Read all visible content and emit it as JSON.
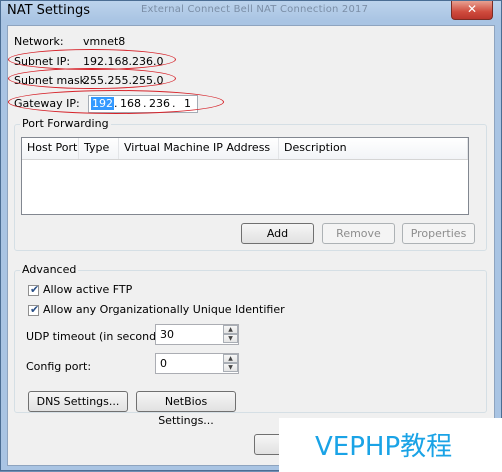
{
  "window": {
    "title": "NAT Settings",
    "background_tabs": "External Connect Bell       NAT Connection    2017",
    "close_glyph": "✕"
  },
  "info": {
    "network_label": "Network:",
    "network_value": "vmnet8",
    "subnet_ip_label": "Subnet IP:",
    "subnet_ip_value": "192.168.236.0",
    "subnet_mask_label": "Subnet mask:",
    "subnet_mask_value": "255.255.255.0",
    "gateway_ip_label": "Gateway IP:",
    "gateway_ip": {
      "octet1": "192",
      "octet2": "168",
      "octet3": "236",
      "octet4": "1",
      "sep": "."
    }
  },
  "port_forwarding": {
    "title": "Port Forwarding",
    "columns": [
      "Host Port",
      "Type",
      "Virtual Machine IP Address",
      "Description"
    ],
    "rows": [],
    "add_label": "Add",
    "remove_label": "Remove",
    "properties_label": "Properties"
  },
  "advanced": {
    "title": "Advanced",
    "allow_active_ftp": {
      "label": "Allow active FTP",
      "checked": true
    },
    "allow_oui": {
      "label": "Allow any Organizationally Unique Identifier",
      "checked": true
    },
    "udp_timeout_label": "UDP timeout (in seconds):",
    "udp_timeout_value": "30",
    "config_port_label": "Config port:",
    "config_port_value": "0",
    "dns_settings_label": "DNS Settings...",
    "netbios_settings_label": "NetBios Settings..."
  },
  "watermark": {
    "text": "VEPHP教程"
  },
  "icons": {
    "check": "✔",
    "spin_up": "▲",
    "spin_down": "▼"
  },
  "colors": {
    "annotation_red": "#d6232a",
    "selection_blue": "#3399ff",
    "watermark_blue": "#1aa3e6"
  }
}
